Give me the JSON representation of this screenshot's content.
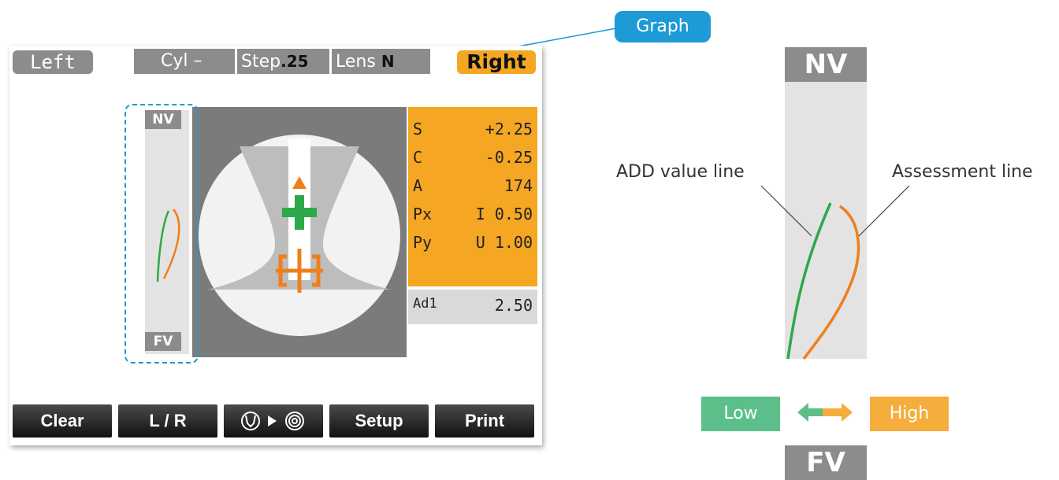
{
  "callout": {
    "label": "Graph"
  },
  "device": {
    "left_button": "Left",
    "right_button": "Right",
    "info_bar": {
      "cyl_label": "Cyl",
      "cyl_value": "–",
      "step_label": "Step",
      "step_value": ".25",
      "lens_label": "Lens",
      "lens_value": "N"
    },
    "graph": {
      "top_label": "NV",
      "bottom_label": "FV"
    },
    "measurements": [
      {
        "key": "S",
        "value": "+2.25"
      },
      {
        "key": "C",
        "value": "-0.25"
      },
      {
        "key": "A",
        "value": "174"
      },
      {
        "key": "Px",
        "value": "I 0.50"
      },
      {
        "key": "Py",
        "value": "U 1.00"
      }
    ],
    "add": {
      "key": "Ad1",
      "value": "2.50"
    },
    "bottom_buttons": [
      "Clear",
      "L / R",
      "",
      "Setup",
      "Print"
    ],
    "mode_button_icons": [
      "lens-pattern-icon",
      "play-arrow-icon",
      "target-rings-icon"
    ]
  },
  "zoom": {
    "top_label": "NV",
    "bottom_label": "FV",
    "add_line_label": "ADD value line",
    "assessment_line_label": "Assessment line",
    "low_label": "Low",
    "high_label": "High"
  },
  "colors": {
    "accent_orange": "#f5a623",
    "add_line_green": "#2ea84a",
    "assessment_orange": "#f07f1a",
    "highlight_blue": "#1e9ad6",
    "low_green": "#5cbf8a",
    "high_orange": "#f5ad3b",
    "panel_gray": "#8c8c8c"
  }
}
